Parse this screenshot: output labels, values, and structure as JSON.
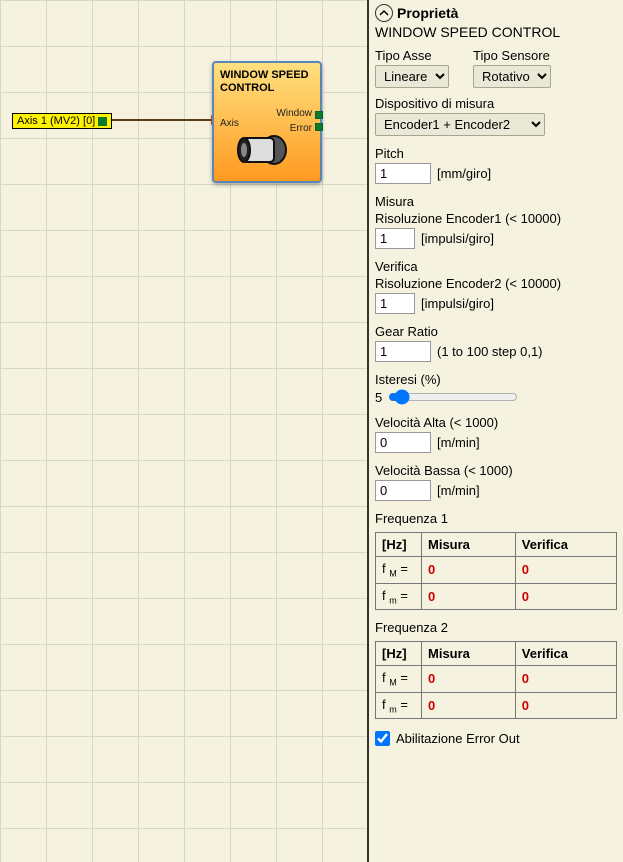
{
  "canvas": {
    "axis_tag": "Axis 1 (MV2) [0]",
    "block": {
      "title": "WINDOW SPEED CONTROL",
      "port_axis": "Axis",
      "port_window": "Window",
      "port_error": "Error"
    }
  },
  "panel": {
    "header": "Proprietà",
    "subtitle": "WINDOW SPEED CONTROL",
    "tipo_asse_label": "Tipo Asse",
    "tipo_asse_value": "Lineare",
    "tipo_sensore_label": "Tipo Sensore",
    "tipo_sensore_value": "Rotativo",
    "dispositivo_label": "Dispositivo di misura",
    "dispositivo_value": "Encoder1 + Encoder2",
    "pitch_label": "Pitch",
    "pitch_value": "1",
    "pitch_unit": "[mm/giro]",
    "misura_label": "Misura",
    "res_enc1_label": "Risoluzione Encoder1 (< 10000)",
    "res_enc1_value": "1",
    "res_enc1_unit": "[impulsi/giro]",
    "verifica_label": "Verifica",
    "res_enc2_label": "Risoluzione Encoder2 (< 10000)",
    "res_enc2_value": "1",
    "res_enc2_unit": "[impulsi/giro]",
    "gear_label": "Gear Ratio",
    "gear_value": "1",
    "gear_unit": "(1 to 100 step 0,1)",
    "isteresi_label": "Isteresi (%)",
    "isteresi_value": "5",
    "vel_alta_label": "Velocità Alta (< 1000)",
    "vel_alta_value": "0",
    "vel_alta_unit": "[m/min]",
    "vel_bassa_label": "Velocità Bassa (< 1000)",
    "vel_bassa_value": "0",
    "vel_bassa_unit": "[m/min]",
    "freq1_label": "Frequenza 1",
    "freq2_label": "Frequenza 2",
    "col_hz": "[Hz]",
    "col_misura": "Misura",
    "col_verifica": "Verifica",
    "row_fM": "f ",
    "row_fM_sub": "M",
    "row_fM_eq": " =",
    "row_fm": "f ",
    "row_fm_sub": "m",
    "row_fm_eq": " =",
    "freq1": {
      "fM_misura": "0",
      "fM_verifica": "0",
      "fm_misura": "0",
      "fm_verifica": "0"
    },
    "freq2": {
      "fM_misura": "0",
      "fM_verifica": "0",
      "fm_misura": "0",
      "fm_verifica": "0"
    },
    "enable_error_label": "Abilitazione Error Out",
    "enable_error_checked": true
  }
}
